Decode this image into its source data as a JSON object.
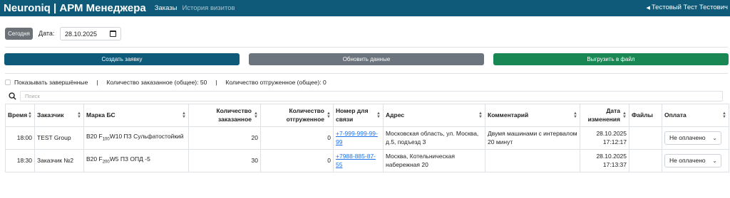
{
  "navbar": {
    "brand": "Neuroniq | АРМ Менеджера",
    "links": [
      "Заказы",
      "История визитов"
    ],
    "user": "Тестовый Тест Тестович"
  },
  "date_row": {
    "today_label": "Сегодня",
    "date_label": "Дата:",
    "date_value": "28.10.2025"
  },
  "actions": {
    "create": "Создать заявку",
    "refresh": "Обновить данные",
    "export": "Выгрузить в файл"
  },
  "info": {
    "show_completed": "Показывать завершённые",
    "sep": "|",
    "ordered_total": "Количество заказанное (общее): 50",
    "shipped_total": "Количество отгруженное (общее): 0"
  },
  "search": {
    "placeholder": "Поиск"
  },
  "table": {
    "headers": [
      "Время",
      "Заказчик",
      "Марка БС",
      "Количество заказанное",
      "Количество отгруженное",
      "Номер для связи",
      "Адрес",
      "Комментарий",
      "Дата изменения",
      "Файлы",
      "Оплата"
    ],
    "rows": [
      {
        "time": "18:00",
        "customer": "TEST Group",
        "brand": {
          "a": "B20 F",
          "sub1": "100",
          "b": "W10 ПЗ Сульфатостойкий"
        },
        "ordered": "20",
        "shipped": "0",
        "phone": "+7-999-999-99-99",
        "address": "Московская область, ул. Москва, д.5, подъезд 3",
        "comment": "Двумя машинами с интервалом 20 минут",
        "date": "28.10.2025",
        "time_changed": "17:12:17",
        "files": "",
        "payment": "Не оплачено"
      },
      {
        "time": "18:30",
        "customer": "Заказчик №2",
        "brand": {
          "a": "B20 F",
          "sub1": "200",
          "b": "W5 ПЗ ОПД -5"
        },
        "ordered": "30",
        "shipped": "0",
        "phone": "+7988-885-87-55",
        "address": "Москва, Котельническая набережная 20",
        "comment": "",
        "date": "28.10.2025",
        "time_changed": "17:13:37",
        "files": "",
        "payment": "Не оплачено"
      }
    ]
  }
}
